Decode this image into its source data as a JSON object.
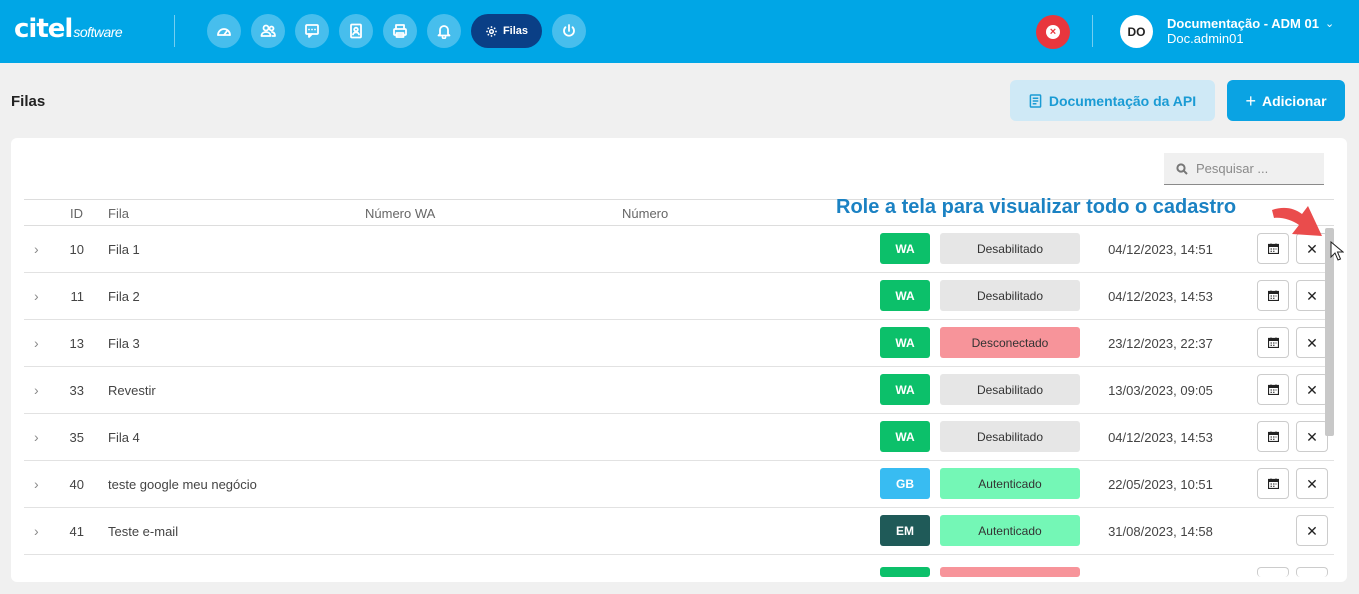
{
  "header": {
    "logo_main": "citel",
    "logo_sub": "software",
    "nav_items": [
      {
        "icon": "dashboard-icon"
      },
      {
        "icon": "users-icon"
      },
      {
        "icon": "chat-icon"
      },
      {
        "icon": "contacts-icon"
      },
      {
        "icon": "printer-icon"
      },
      {
        "icon": "bell-icon"
      },
      {
        "icon": "gear-icon",
        "label": "Filas",
        "active": true
      },
      {
        "icon": "power-icon"
      }
    ],
    "user_initials": "DO",
    "user_name": "Documentação - ADM 01",
    "user_login": "Doc.admin01"
  },
  "page": {
    "title": "Filas",
    "doc_button": "Documentação da API",
    "add_button": "Adicionar",
    "search_placeholder": "Pesquisar ..."
  },
  "table": {
    "columns": [
      "ID",
      "Fila",
      "Número WA",
      "Número"
    ],
    "rows": [
      {
        "id": "10",
        "name": "Fila 1",
        "type": "WA",
        "status": "Desabilitado",
        "date": "04/12/2023, 14:51",
        "has_schedule": true
      },
      {
        "id": "11",
        "name": "Fila 2",
        "type": "WA",
        "status": "Desabilitado",
        "date": "04/12/2023, 14:53",
        "has_schedule": true
      },
      {
        "id": "13",
        "name": "Fila 3",
        "type": "WA",
        "status": "Desconectado",
        "date": "23/12/2023, 22:37",
        "has_schedule": true
      },
      {
        "id": "33",
        "name": "Revestir",
        "type": "WA",
        "status": "Desabilitado",
        "date": "13/03/2023, 09:05",
        "has_schedule": true
      },
      {
        "id": "35",
        "name": "Fila 4",
        "type": "WA",
        "status": "Desabilitado",
        "date": "04/12/2023, 14:53",
        "has_schedule": true
      },
      {
        "id": "40",
        "name": "teste google meu negócio",
        "type": "GB",
        "status": "Autenticado",
        "date": "22/05/2023, 10:51",
        "has_schedule": true
      },
      {
        "id": "41",
        "name": "Teste e-mail",
        "type": "EM",
        "status": "Autenticado",
        "date": "31/08/2023, 14:58",
        "has_schedule": false
      }
    ]
  },
  "annotation": {
    "hint": "Role a tela para visualizar todo o cadastro"
  },
  "colors": {
    "topbar": "#00a6e6",
    "type_WA": "#0cc06a",
    "type_GB": "#38bcf2",
    "type_EM": "#1f5a58",
    "status_Desabilitado": "#e6e6e6",
    "status_Desconectado": "#f7949a",
    "status_Autenticado": "#74f7b6",
    "hint_arrow": "#ea4c4c"
  }
}
